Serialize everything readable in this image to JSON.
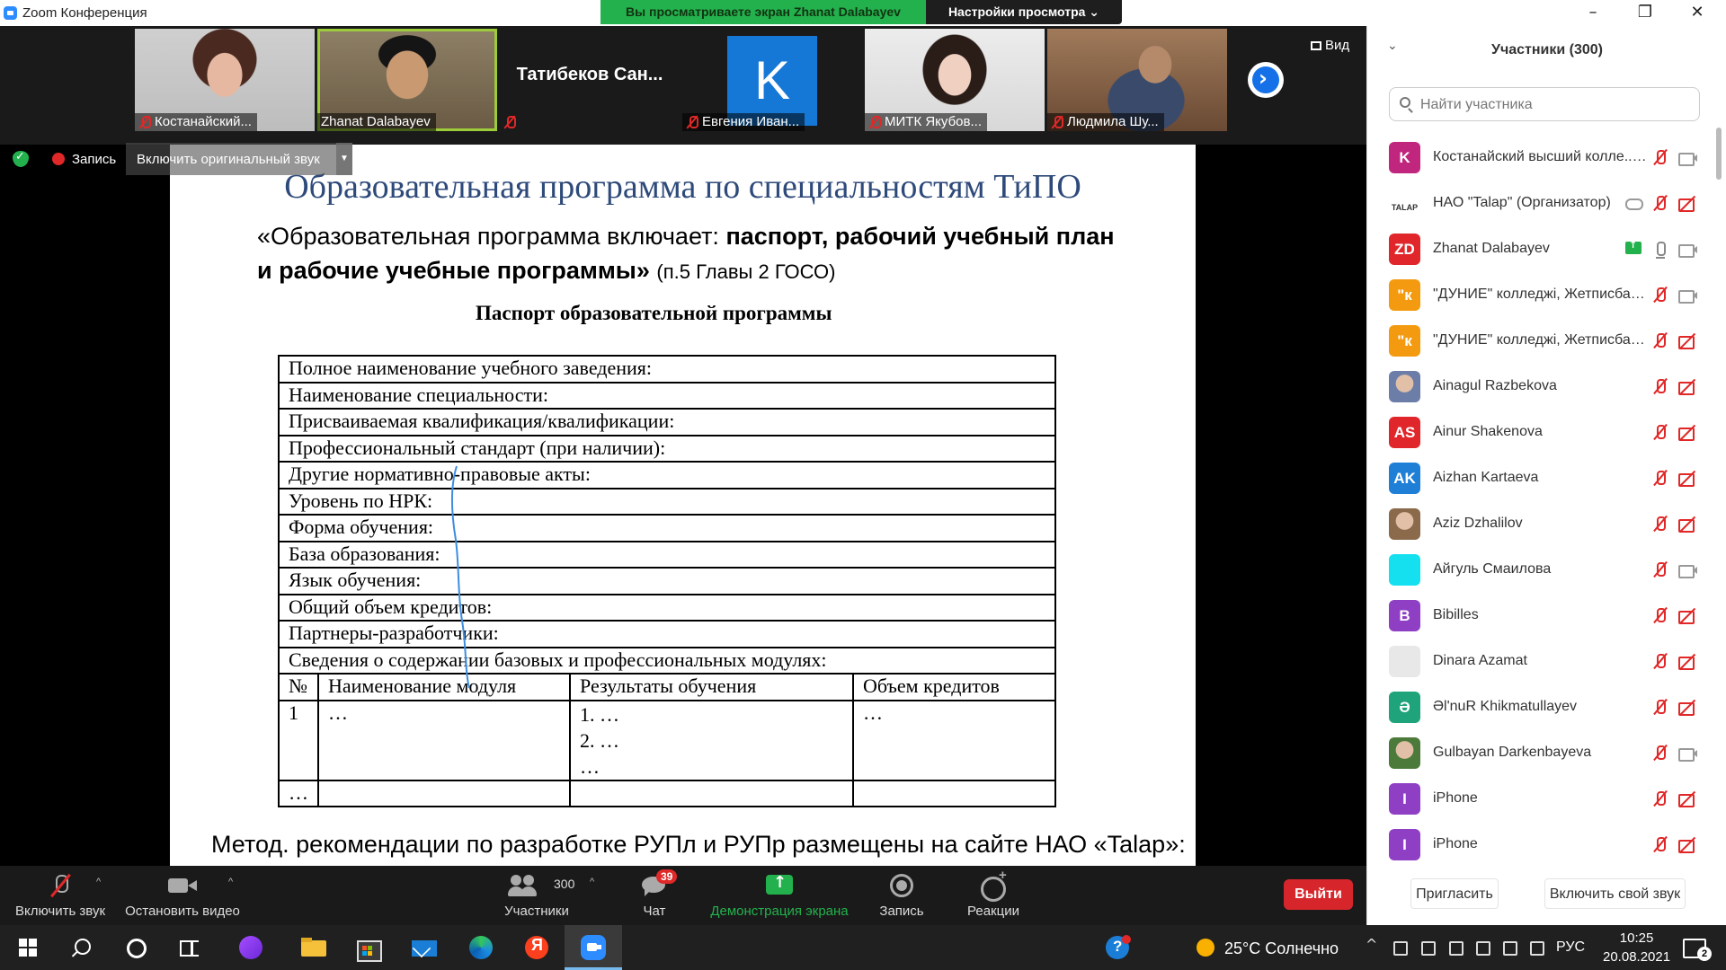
{
  "window": {
    "title": "Zoom Конференция"
  },
  "share_banner": {
    "text": "Вы просматриваете экран Zhanat Dalabayev",
    "view_options": "Настройки просмотра ⌄"
  },
  "video_strip": {
    "tiles": [
      {
        "name": "Костанайский...",
        "muted": true
      },
      {
        "name": "Zhanat Dalabayev",
        "muted": false,
        "active_speaker": true
      },
      {
        "name": "Татибеков  Сан...",
        "muted": true
      },
      {
        "name": "Евгения Иван...",
        "muted": true,
        "avatar_letter": "K"
      },
      {
        "name": "МИТК Якубов...",
        "muted": true
      },
      {
        "name": "Людмила Шу...",
        "muted": true
      }
    ],
    "view_label": "Вид"
  },
  "recording": {
    "label": "Запись",
    "original_sound": "Включить оригинальный звук"
  },
  "slide": {
    "title": "Образовательная программа  по специальностям ТиПО",
    "quote_plain": "«Образовательная программа включает: ",
    "quote_bold": "паспорт, рабочий учебный план и рабочие учебные программы",
    "quote_close": "» ",
    "quote_ref": "(п.5 Главы 2 ГОСО)",
    "passport_title": "Паспорт  образовательной  программы",
    "rows": [
      "Полное  наименование  учебного  заведения:",
      "Наименование  специальности:",
      "Присваиваемая  квалификация/квалификации:",
      "Профессиональный  стандарт  (при  наличии):",
      "Другие  нормативно-правовые  акты:",
      "Уровень  по  НРК:",
      "Форма  обучения:",
      "База  образования:",
      "Язык  обучения:",
      "Общий  объем  кредитов:",
      "Партнеры-разработчики:",
      "Сведения  о  содержании  базовых  и  профессиональных  модулях:"
    ],
    "module_headers": [
      "№",
      "Наименование  модуля",
      "Результаты  обучения",
      "Объем  кредитов"
    ],
    "module_row": {
      "num": "1",
      "name": "…",
      "results": [
        "1.   …",
        "2.   …",
        "…"
      ],
      "credits": "…"
    },
    "module_last": "…",
    "footer": "Метод. рекомендации по  разработке РУПл и РУПр размещены на сайте НАО «Talap»:"
  },
  "controls": {
    "unmute": "Включить звук",
    "stop_video": "Остановить видео",
    "participants": "Участники",
    "participants_count": "300",
    "chat": "Чат",
    "chat_badge": "39",
    "share_screen": "Демонстрация экрана",
    "record": "Запись",
    "reactions": "Реакции",
    "leave": "Выйти"
  },
  "panel": {
    "title": "Участники (300)",
    "search_placeholder": "Найти участника",
    "participants": [
      {
        "name": "Костанайский высший колле... (Я)",
        "initials": "K",
        "color": "#c0267e",
        "mic": "off",
        "video": "gray"
      },
      {
        "name": "НАО \"Talap\" (Организатор)",
        "initials": "TALAP",
        "color": "#ffffff",
        "mic": "off",
        "video": "off",
        "cloud": true
      },
      {
        "name": "Zhanat Dalabayev",
        "initials": "ZD",
        "color": "#e0262b",
        "mic": "on",
        "video": "gray",
        "sharing": true
      },
      {
        "name": "\"ДУНИЕ\" колледжі, Жетписбаев...",
        "initials": "\"к",
        "color": "#f39a10",
        "mic": "off",
        "video": "gray"
      },
      {
        "name": "\"ДУНИЕ\" колледжі, Жетписбаев...",
        "initials": "\"к",
        "color": "#f39a10",
        "mic": "off",
        "video": "off"
      },
      {
        "name": "Ainagul Razbekova",
        "initials": "",
        "color": "#6c7ea8",
        "mic": "off",
        "video": "off",
        "photo": true
      },
      {
        "name": "Ainur Shakenova",
        "initials": "AS",
        "color": "#e0262b",
        "mic": "off",
        "video": "off"
      },
      {
        "name": "Aizhan Kartaeva",
        "initials": "AK",
        "color": "#1f7fd6",
        "mic": "off",
        "video": "off"
      },
      {
        "name": "Aziz Dzhalilov",
        "initials": "",
        "color": "#8a6a4a",
        "mic": "off",
        "video": "off",
        "photo": true
      },
      {
        "name": "Айгуль Смаилова",
        "initials": "",
        "color": "#14e0f0",
        "mic": "off",
        "video": "gray"
      },
      {
        "name": "Bibilles",
        "initials": "B",
        "color": "#8e3fc4",
        "mic": "off",
        "video": "off"
      },
      {
        "name": "Dinara Azamat",
        "initials": "",
        "color": "#e8e8e8",
        "mic": "off",
        "video": "off"
      },
      {
        "name": "Əl'nuR Khikmatullayev",
        "initials": "Ə",
        "color": "#1fa37a",
        "mic": "off",
        "video": "off"
      },
      {
        "name": "Gulbayan Darkenbayeva",
        "initials": "",
        "color": "#4c7a3a",
        "mic": "off",
        "video": "gray",
        "photo": true
      },
      {
        "name": "iPhone",
        "initials": "I",
        "color": "#8e3fc4",
        "mic": "off",
        "video": "off"
      },
      {
        "name": "iPhone",
        "initials": "I",
        "color": "#8e3fc4",
        "mic": "off",
        "video": "off"
      }
    ],
    "invite": "Пригласить",
    "unmute_self": "Включить свой звук"
  },
  "taskbar": {
    "weather": "25°C  Солнечно",
    "lang": "РУС",
    "time": "10:25",
    "date": "20.08.2021",
    "notifications": "2",
    "yandex_letter": "Я",
    "help_letter": "?"
  }
}
